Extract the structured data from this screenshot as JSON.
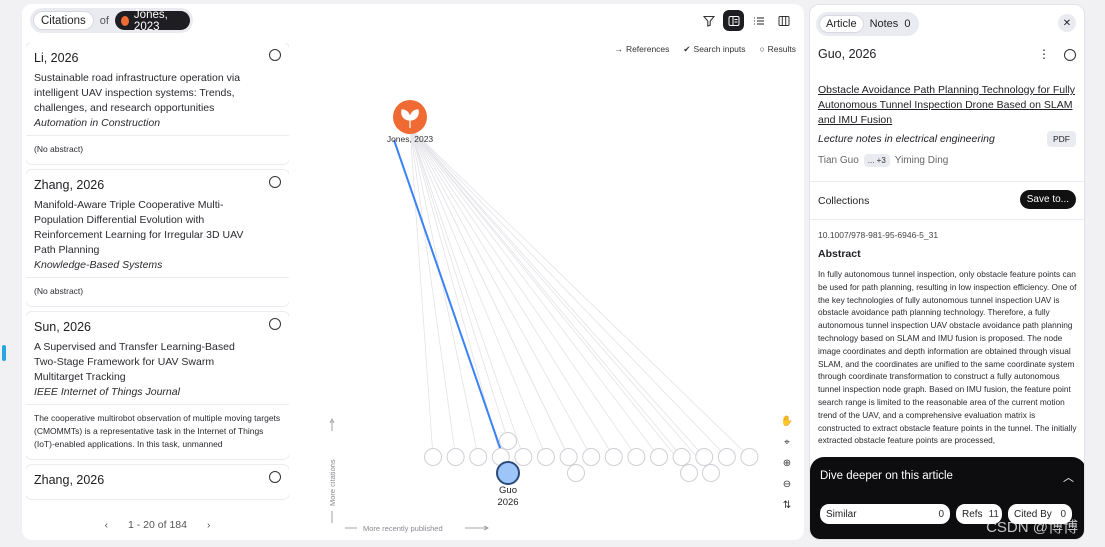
{
  "topbar": {
    "citations_label": "Citations",
    "of_label": "of",
    "source_paper": "Jones, 2023"
  },
  "list": {
    "cards": [
      {
        "title": "Li, 2026",
        "text": "Sustainable road infrastructure operation via intelligent UAV inspection systems: Trends, challenges, and research opportunities",
        "journal": "Automation in Construction",
        "abstract": "(No abstract)"
      },
      {
        "title": "Zhang, 2026",
        "text": "Manifold-Aware Triple Cooperative Multi-Population Differential Evolution with Reinforcement Learning for Irregular 3D UAV Path Planning",
        "journal": "Knowledge-Based Systems",
        "abstract": "(No abstract)"
      },
      {
        "title": "Sun, 2026",
        "text": "A Supervised and Transfer Learning-Based Two-Stage Framework for UAV Swarm Multitarget Tracking",
        "journal": "IEEE Internet of Things Journal",
        "abstract": "The cooperative multirobot observation of multiple moving targets (CMOMMTs) is a representative task in the Internet of Things (IoT)-enabled applications. In this task, unmanned"
      },
      {
        "title": "Zhang, 2026",
        "text": "",
        "journal": "",
        "abstract": ""
      }
    ],
    "pager": {
      "prev": "‹",
      "range": "1 - 20 of 184",
      "next": "›"
    }
  },
  "graph": {
    "legend": {
      "references": "References",
      "search_inputs": "Search inputs",
      "results": "Results"
    },
    "source_label": "Jones, 2023",
    "selected_label_name": "Guo",
    "selected_label_year": "2026",
    "axis_y": "More citations",
    "axis_x": "More recently published",
    "accent": "#3b82f6",
    "source_color": "#f06a33"
  },
  "panel": {
    "tab_article": "Article",
    "tab_notes": "Notes",
    "notes_count": "0",
    "title": "Guo, 2026",
    "article_title": "Obstacle Avoidance Path Planning Technology for Fully Autonomous Tunnel Inspection Drone Based on SLAM and IMU Fusion",
    "journal": "Lecture notes in electrical engineering",
    "pdf": "PDF",
    "author1": "Tian Guo",
    "author_more": "... +3",
    "author2": "Yiming Ding",
    "collections": "Collections",
    "save": "Save to...",
    "doi": "10.1007/978-981-95-6946-5_31",
    "abstract_heading": "Abstract",
    "abstract": "In fully autonomous tunnel inspection, only obstacle feature points can be used for path planning, resulting in low inspection efficiency. One of the key technologies of fully autonomous tunnel inspection UAV is obstacle avoidance path planning technology. Therefore, a fully autonomous tunnel inspection UAV obstacle avoidance path planning technology based on SLAM and IMU fusion is proposed. The node image coordinates and depth information are obtained through visual SLAM, and the coordinates are unified to the same coordinate system through coordinate transformation to construct a fully autonomous tunnel inspection node graph. Based on IMU fusion, the feature point search range is limited to the reasonable area of the current motion trend of the UAV, and a comprehensive evaluation matrix is constructed to extract obstacle feature points in the tunnel. The initially extracted obstacle feature points are processed,",
    "dive_title": "Dive deeper on this article",
    "similar": "Similar",
    "similar_count": "0",
    "refs": "Refs",
    "refs_count": "11",
    "cited_by": "Cited By",
    "cited_by_count": "0",
    "watermark": "CSDN @博博"
  }
}
